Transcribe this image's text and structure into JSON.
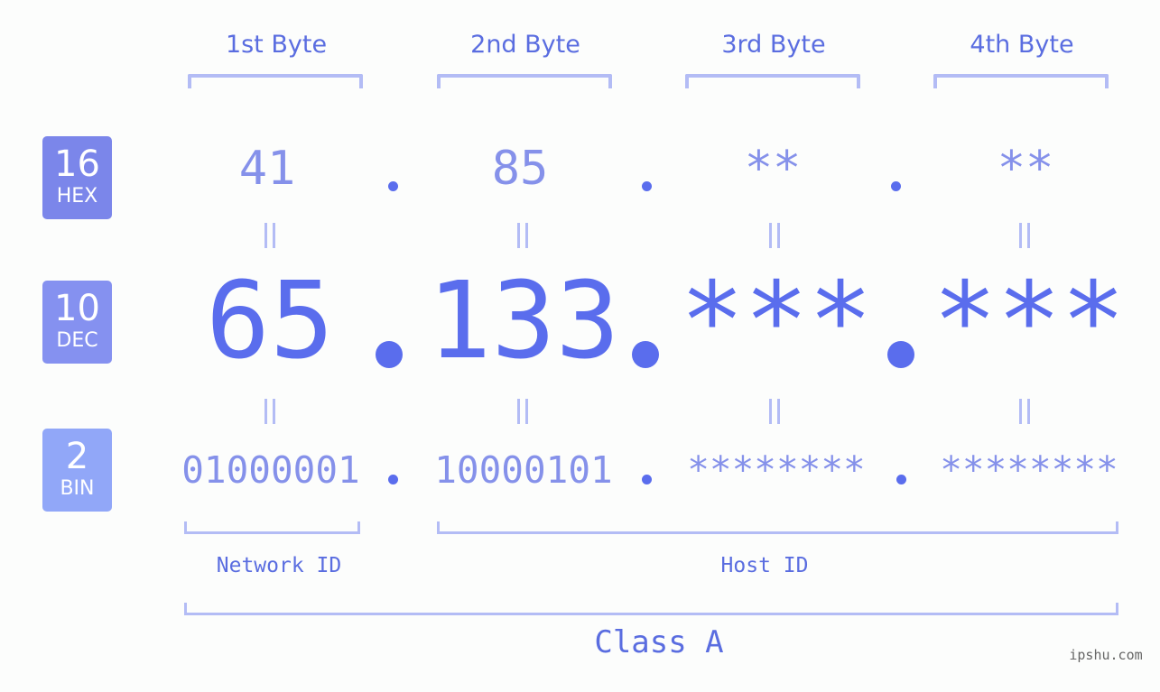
{
  "colors": {
    "background": "#fcfdfc",
    "hex_badge": "#7b86ea",
    "dec_badge": "#8591f0",
    "bin_badge": "#91a7f8",
    "hex_bin_text": "#8591ea",
    "dec_text": "#5a6ded",
    "bracket": "#b3bcf5",
    "label_text": "#5a6de0"
  },
  "badges": [
    {
      "number": "16",
      "label": "HEX"
    },
    {
      "number": "10",
      "label": "DEC"
    },
    {
      "number": "2",
      "label": "BIN"
    }
  ],
  "byte_headers": [
    "1st Byte",
    "2nd Byte",
    "3rd Byte",
    "4th Byte"
  ],
  "hex": [
    "41",
    "85",
    "**",
    "**"
  ],
  "dec": [
    "65",
    "133",
    "***",
    "***"
  ],
  "bin": [
    "01000001",
    "10000101",
    "********",
    "********"
  ],
  "separator": ".",
  "equals_symbol": "||",
  "network_id_label": "Network ID",
  "host_id_label": "Host ID",
  "class_label": "Class A",
  "watermark": "ipshu.com"
}
